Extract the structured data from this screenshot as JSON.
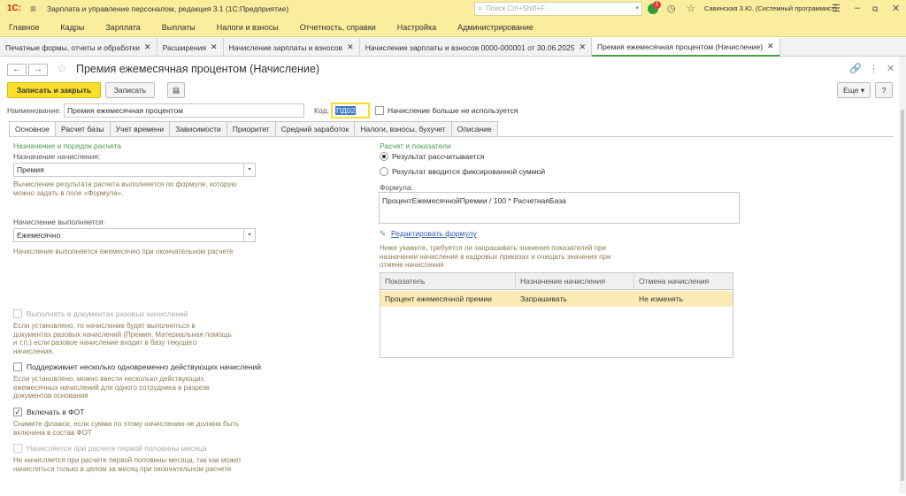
{
  "titlebar": {
    "logo": "1С:",
    "app_title": "Зарплата и управление персоналом, редакция 3.1  (1С:Предприятие)",
    "search_placeholder": "Поиск Ctrl+Shift+F",
    "notifications": "1",
    "user": "Савинская З.Ю. (Системный программист)"
  },
  "menu": [
    "Главное",
    "Кадры",
    "Зарплата",
    "Выплаты",
    "Налоги и взносы",
    "Отчетность, справки",
    "Настройка",
    "Администрирование"
  ],
  "open_tabs": [
    "Печатные формы, отчеты и обработки",
    "Расширения",
    "Начисление зарплаты и взносов",
    "Начисление зарплаты и взносов 0000-000001 от 30.06.2025",
    "Премия ежемесячная процентом (Начисление)"
  ],
  "form": {
    "title": "Премия ежемесячная процентом (Начисление)",
    "btn_save_close": "Записать и закрыть",
    "btn_save": "Записать",
    "btn_more": "Еще ▾",
    "help": "?",
    "name_label": "Наименование:",
    "name_value": "Премия ежемесячная процентом",
    "code_label": "Код:",
    "code_value": "ПД02",
    "unused_label": "Начисление больше не используется",
    "tabs": [
      "Основное",
      "Расчет базы",
      "Учет времени",
      "Зависимости",
      "Приоритет",
      "Средний заработок",
      "Налоги, взносы, бухучет",
      "Описание"
    ],
    "left": {
      "section": "Назначение и порядок расчета",
      "purpose_label": "Назначение начисления:",
      "purpose_value": "Премия",
      "purpose_hint": "Вычисление результата расчета выполняется по формуле, которую можно задать в поле «Формула».",
      "exec_label": "Начисление выполняется:",
      "exec_value": "Ежемесячно",
      "exec_hint": "Начисление выполняется ежемесячно при окончательном расчете",
      "cb1_label": "Выполнять в документах разовых начислений",
      "cb1_hint": "Если установлено, то начисление будет выполняться в документах разовых начислений (Премия, Материальная помощь и т.п.) если разовое начисление входит в базу текущего начисления.",
      "cb2_label": "Поддерживает несколько одновременно действующих начислений",
      "cb2_hint": "Если установлено, можно ввести несколько действующих ежемесячных начислений для одного сотрудника в разрезе документов основания",
      "cb3_label": "Включать в ФОТ",
      "cb3_hint": "Снимите флажок, если сумма по этому начислению не должна быть включена в состав ФОТ",
      "cb4_label": "Начисляется при расчете первой половины месяца",
      "cb4_hint": "Не начисляется при расчете первой половины месяца, так как может начисляться только в целом за месяц при окончательном расчете"
    },
    "right": {
      "section": "Расчет и показатели",
      "radio1": "Результат рассчитывается",
      "radio2": "Результат вводится фиксированной суммой",
      "formula_label": "Формула:",
      "formula_value": "ПроцентЕжемесячнойПремии / 100 * РасчетнаяБаза",
      "edit_link": "Редактировать формулу",
      "hint": "Ниже укажите, требуется ли запрашивать значения показателей при назначении начисления в кадровых приказах и очищать значения при отмене начисления",
      "table_headers": [
        "Показатель",
        "Назначение начисления",
        "Отмена начисления"
      ],
      "table_row": [
        "Процент ежемесячной премии",
        "Запрашивать",
        "Не изменять"
      ]
    }
  }
}
